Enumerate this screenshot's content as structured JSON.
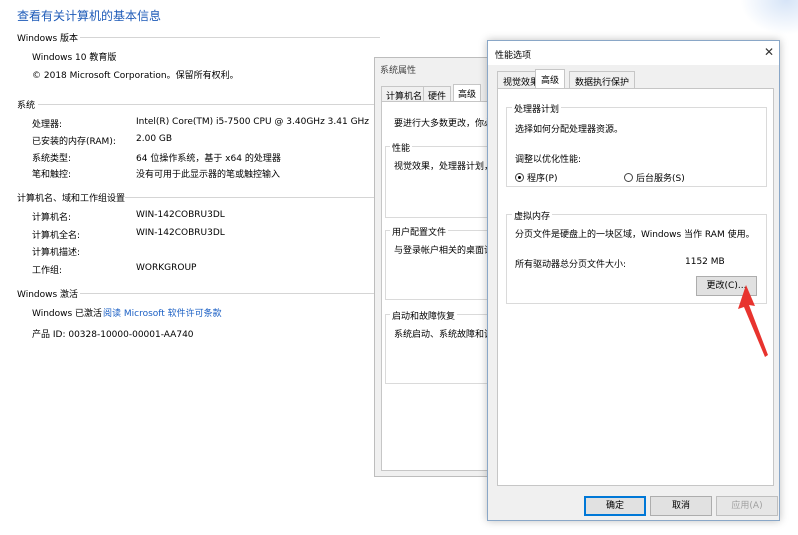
{
  "page": {
    "title": "查看有关计算机的基本信息",
    "windows_edition": {
      "header": "Windows 版本",
      "name": "Windows 10 教育版",
      "copyright": "© 2018 Microsoft Corporation。保留所有权利。"
    },
    "system": {
      "header": "系统",
      "rows": [
        {
          "label": "处理器:",
          "value": "Intel(R) Core(TM) i5-7500 CPU @ 3.40GHz   3.41 GHz"
        },
        {
          "label": "已安装的内存(RAM):",
          "value": "2.00 GB"
        },
        {
          "label": "系统类型:",
          "value": "64 位操作系统，基于 x64 的处理器"
        },
        {
          "label": "笔和触控:",
          "value": "没有可用于此显示器的笔或触控输入"
        }
      ]
    },
    "computer": {
      "header": "计算机名、域和工作组设置",
      "rows": [
        {
          "label": "计算机名:",
          "value": "WIN-142COBRU3DL"
        },
        {
          "label": "计算机全名:",
          "value": "WIN-142COBRU3DL"
        },
        {
          "label": "计算机描述:",
          "value": ""
        },
        {
          "label": "工作组:",
          "value": "WORKGROUP"
        }
      ]
    },
    "activation": {
      "header": "Windows 激活",
      "status": "Windows 已激活",
      "link": "阅读 Microsoft 软件许可条款",
      "product_id": "产品 ID: 00328-10000-00001-AA740"
    }
  },
  "sysprop": {
    "title": "系统属性",
    "tabs": [
      "计算机名",
      "硬件",
      "高级"
    ],
    "intro": "要进行大多数更改，你必",
    "groups": [
      {
        "title": "性能",
        "text": "视觉效果，处理器计划，"
      },
      {
        "title": "用户配置文件",
        "text": "与登录帐户相关的桌面设"
      },
      {
        "title": "启动和故障恢复",
        "text": "系统启动、系统故障和调"
      }
    ]
  },
  "perf": {
    "title": "性能选项",
    "close_glyph": "✕",
    "tabs": [
      "视觉效果",
      "高级",
      "数据执行保护"
    ],
    "processor": {
      "title": "处理器计划",
      "desc": "选择如何分配处理器资源。",
      "adjust": "调整以优化性能:",
      "option1": "程序(P)",
      "option2": "后台服务(S)"
    },
    "vmem": {
      "title": "虚拟内存",
      "desc": "分页文件是硬盘上的一块区域，Windows 当作 RAM 使用。",
      "total_label": "所有驱动器总分页文件大小:",
      "total_value": "1152 MB",
      "change_button": "更改(C)..."
    },
    "buttons": {
      "ok": "确定",
      "cancel": "取消",
      "apply": "应用(A)"
    }
  },
  "colors": {
    "title_blue": "#1e5bb8",
    "link_blue": "#1a5fc4",
    "arrow_red": "#e8332e"
  }
}
